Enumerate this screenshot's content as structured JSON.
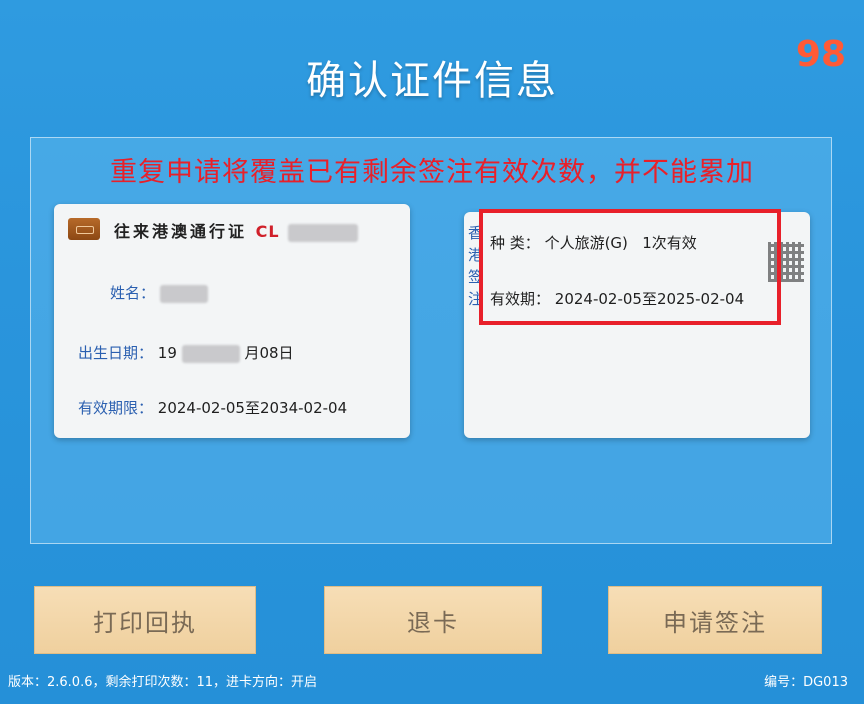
{
  "header": {
    "title": "确认证件信息",
    "countdown": "98"
  },
  "warning": "重复申请将覆盖已有剩余签注有效次数，并不能累加",
  "permit_card": {
    "heading": "往来港澳通行证",
    "card_no_visible": "CL",
    "name_label": "姓名：",
    "birth_label": "出生日期：",
    "birth_prefix": "19",
    "birth_suffix": "月08日",
    "validity_label": "有效期限：",
    "validity_value": "2024-02-05至2034-02-04"
  },
  "endorsement_card": {
    "side_text": "香港签注",
    "kind_label": "种 类：",
    "kind_value": "个人旅游(G)   1次有效",
    "validity_label": "有效期：",
    "validity_value": "2024-02-05至2025-02-04"
  },
  "buttons": {
    "print": "打印回执",
    "exit": "退卡",
    "apply": "申请签注"
  },
  "footer": {
    "info": "版本：2.6.0.6，剩余打印次数：11，进卡方向：开启",
    "device": "编号：DG013"
  },
  "colors": {
    "background": "#2a95dc",
    "warning": "#e8202a",
    "countdown": "#ff5a36",
    "button": "#f3d7a8"
  }
}
